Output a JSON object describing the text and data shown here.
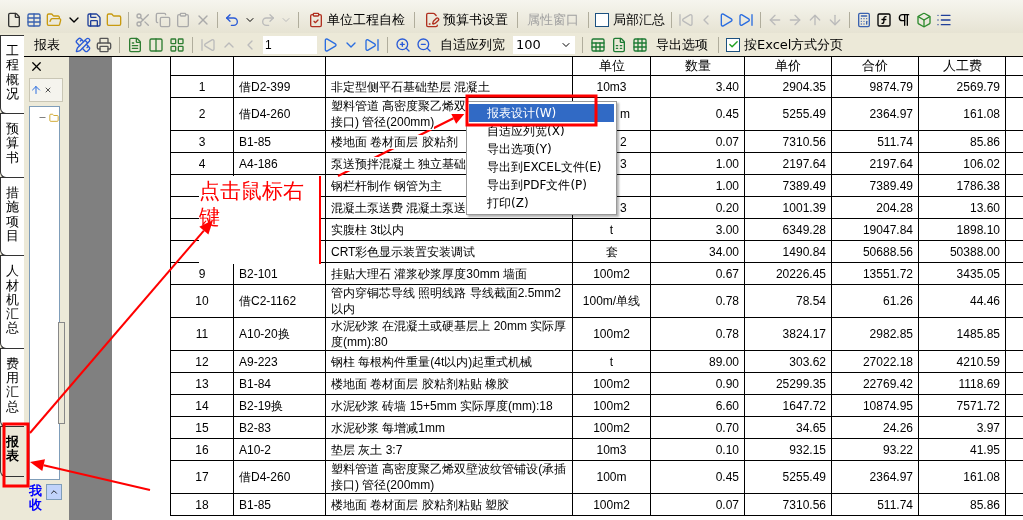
{
  "main_toolbar": {
    "buttons": [
      {
        "label": "单位工程自检",
        "disabled": false
      },
      {
        "label": "预算书设置",
        "disabled": false
      },
      {
        "label": "属性窗口",
        "disabled": true
      }
    ],
    "partial_summary": {
      "label": "局部汇总",
      "checked": false
    }
  },
  "report_toolbar": {
    "panel_title": "报表",
    "page": "1",
    "fit_width": "自适应列宽",
    "zoom": "100",
    "export_options": "导出选项",
    "excel_paging": {
      "label": "按Excel方式分页",
      "checked": true
    }
  },
  "side_tabs": [
    {
      "label": "工程概况",
      "selected": false
    },
    {
      "label": "预算书",
      "selected": false
    },
    {
      "label": "措施项目",
      "selected": false
    },
    {
      "label": "人材机汇总",
      "selected": false
    },
    {
      "label": "费用汇总",
      "selected": false
    },
    {
      "label": "报表",
      "selected": true
    }
  ],
  "panel": {
    "footer_label": "我收"
  },
  "table": {
    "columns": [
      "单位",
      "数量",
      "单价",
      "合价",
      "人工费"
    ],
    "rows": [
      {
        "no": "1",
        "code": "借D2-399",
        "name": "非定型侧平石基础垫层 混凝土",
        "unit": "10m3",
        "qty": "3.40",
        "price": "2904.35",
        "total": "9874.79",
        "labor": "2569.79"
      },
      {
        "no": "2",
        "code": "借D4-260",
        "name_lines": [
          "塑料管道 高密度聚乙烯双",
          "接口) 管径(200mm)"
        ],
        "unit": "m",
        "unit_partly_hidden": true,
        "qty": "0.45",
        "price": "5255.49",
        "total": "2364.97",
        "labor": "161.08"
      },
      {
        "no": "3",
        "code": "B1-85",
        "name": "楼地面 卷材面层 胶粘剂",
        "unit": "2",
        "unit_partly_hidden": true,
        "qty": "0.07",
        "price": "7310.56",
        "total": "511.74",
        "labor": "85.86"
      },
      {
        "no": "4",
        "code": "A4-186",
        "name": "泵送预拌混凝土 独立基础",
        "unit": "3",
        "unit_partly_hidden": true,
        "qty": "1.00",
        "price": "2197.64",
        "total": "2197.64",
        "labor": "106.02"
      },
      {
        "name": "钢栏杆制作 钢管为主",
        "qty": "1.00",
        "price": "7389.49",
        "total": "7389.49",
        "labor": "1786.38"
      },
      {
        "name": "混凝土泵送费 混凝土泵送",
        "unit": "3",
        "unit_partly_hidden": true,
        "qty": "0.20",
        "price": "1001.39",
        "total": "204.28",
        "labor": "13.60"
      },
      {
        "name": "实腹柱 3t以内",
        "unit": "t",
        "qty": "3.00",
        "price": "6349.28",
        "total": "19047.84",
        "labor": "1898.10"
      },
      {
        "name": "CRT彩色显示装置安装调试",
        "unit": "套",
        "qty": "34.00",
        "price": "1490.84",
        "total": "50688.56",
        "labor": "50388.00"
      },
      {
        "no": "9",
        "code": "B2-101",
        "name": "挂贴大理石 灌浆砂浆厚度30mm 墙面",
        "unit": "100m2",
        "qty": "0.67",
        "price": "20226.45",
        "total": "13551.72",
        "labor": "3435.05"
      },
      {
        "no": "10",
        "code": "借C2-1162",
        "name": "管内穿铜芯导线 照明线路 导线截面2.5mm2以内",
        "unit": "100m/单线",
        "qty": "0.78",
        "price": "78.54",
        "total": "61.26",
        "labor": "44.46"
      },
      {
        "no": "11",
        "code": "A10-20换",
        "name": "水泥砂浆 在混凝土或硬基层上 20mm 实际厚度(mm):80",
        "unit": "100m2",
        "qty": "0.78",
        "price": "3824.17",
        "total": "2982.85",
        "labor": "1485.85"
      },
      {
        "no": "12",
        "code": "A9-223",
        "name": "钢柱 每根构件重量(4t以内)起重式机械",
        "unit": "t",
        "qty": "89.00",
        "price": "303.62",
        "total": "27022.18",
        "labor": "4210.59"
      },
      {
        "no": "13",
        "code": "B1-84",
        "name": "楼地面 卷材面层 胶粘剂粘贴 橡胶",
        "unit": "100m2",
        "qty": "0.90",
        "price": "25299.35",
        "total": "22769.42",
        "labor": "1118.69"
      },
      {
        "no": "14",
        "code": "B2-19换",
        "name": "水泥砂浆 砖墙 15+5mm 实际厚度(mm):18",
        "unit": "100m2",
        "qty": "6.60",
        "price": "1647.72",
        "total": "10874.95",
        "labor": "7571.72"
      },
      {
        "no": "15",
        "code": "B2-83",
        "name": "水泥砂浆 每增减1mm",
        "unit": "100m2",
        "qty": "0.70",
        "price": "34.65",
        "total": "24.26",
        "labor": "3.97"
      },
      {
        "no": "16",
        "code": "A10-2",
        "name": "垫层 灰土 3:7",
        "unit": "10m3",
        "qty": "0.10",
        "price": "932.15",
        "total": "93.22",
        "labor": "41.95"
      },
      {
        "no": "17",
        "code": "借D4-260",
        "name": "塑料管道 高密度聚乙烯双壁波纹管铺设(承插接口) 管径(200mm)",
        "unit": "100m",
        "qty": "0.45",
        "price": "5255.49",
        "total": "2364.97",
        "labor": "161.08"
      },
      {
        "no": "18",
        "code": "B1-85",
        "name": "楼地面 卷材面层 胶粘剂粘贴 塑胶",
        "unit": "100m2",
        "qty": "0.07",
        "price": "7310.56",
        "total": "511.74",
        "labor": "85.86"
      }
    ]
  },
  "context_menu": {
    "items": [
      {
        "label": "报表设计(W)",
        "selected": true
      },
      {
        "label": "自适应列宽(X)",
        "selected": false
      },
      {
        "label": "导出选项(Y)",
        "selected": false
      },
      {
        "label": "导出到EXCEL文件(E)",
        "selected": false
      },
      {
        "label": "导出到PDF文件(P)",
        "selected": false
      },
      {
        "label": "打印(Z)",
        "selected": false
      }
    ]
  },
  "annotation": {
    "text": "点击鼠标右键"
  }
}
